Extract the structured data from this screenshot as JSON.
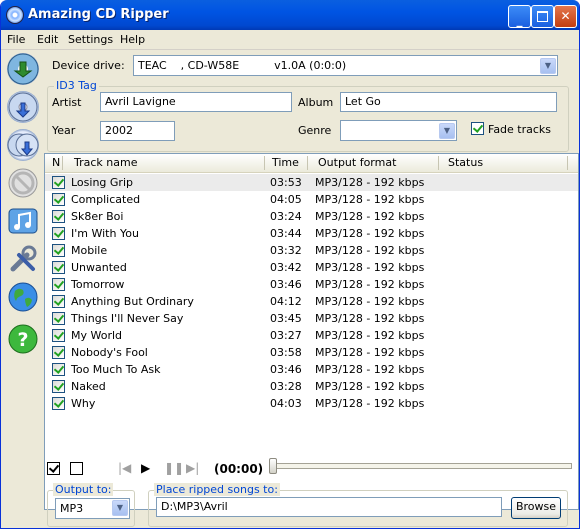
{
  "window": {
    "title": "Amazing CD Ripper"
  },
  "menu": [
    "File",
    "Edit",
    "Settings",
    "Help"
  ],
  "device": {
    "label": "Device drive:",
    "value": "TEAC    , CD-W58E          v1.0A (0:0:0)"
  },
  "id3": {
    "group_title": "ID3 Tag",
    "artist_label": "Artist",
    "artist": "Avril Lavigne",
    "album_label": "Album",
    "album": "Let Go",
    "year_label": "Year",
    "year": "2002",
    "genre_label": "Genre",
    "genre": "",
    "fade_label": "Fade tracks"
  },
  "columns": {
    "num": "N",
    "name": "Track name",
    "time": "Time",
    "format": "Output format",
    "status": "Status"
  },
  "tracks": [
    {
      "name": "Losing Grip",
      "time": "03:53",
      "format": "MP3/128 - 192 kbps",
      "status": ""
    },
    {
      "name": "Complicated",
      "time": "04:05",
      "format": "MP3/128 - 192 kbps",
      "status": ""
    },
    {
      "name": "Sk8er Boi",
      "time": "03:24",
      "format": "MP3/128 - 192 kbps",
      "status": ""
    },
    {
      "name": "I'm With You",
      "time": "03:44",
      "format": "MP3/128 - 192 kbps",
      "status": ""
    },
    {
      "name": "Mobile",
      "time": "03:32",
      "format": "MP3/128 - 192 kbps",
      "status": ""
    },
    {
      "name": "Unwanted",
      "time": "03:42",
      "format": "MP3/128 - 192 kbps",
      "status": ""
    },
    {
      "name": "Tomorrow",
      "time": "03:46",
      "format": "MP3/128 - 192 kbps",
      "status": ""
    },
    {
      "name": "Anything But Ordinary",
      "time": "04:12",
      "format": "MP3/128 - 192 kbps",
      "status": ""
    },
    {
      "name": "Things I'll Never Say",
      "time": "03:45",
      "format": "MP3/128 - 192 kbps",
      "status": ""
    },
    {
      "name": "My World",
      "time": "03:27",
      "format": "MP3/128 - 192 kbps",
      "status": ""
    },
    {
      "name": "Nobody's Fool",
      "time": "03:58",
      "format": "MP3/128 - 192 kbps",
      "status": ""
    },
    {
      "name": "Too Much To Ask",
      "time": "03:46",
      "format": "MP3/128 - 192 kbps",
      "status": ""
    },
    {
      "name": "Naked",
      "time": "03:28",
      "format": "MP3/128 - 192 kbps",
      "status": ""
    },
    {
      "name": "Why",
      "time": "04:03",
      "format": "MP3/128 - 192 kbps",
      "status": ""
    }
  ],
  "player": {
    "time": "(00:00)",
    "position": 0
  },
  "output": {
    "group_title": "Output to:",
    "format": "MP3"
  },
  "destination": {
    "group_title": "Place ripped songs to:",
    "path": "D:\\MP3\\Avril",
    "browse_label": "Browse"
  },
  "sidebar_icons": [
    "rip-cd-icon",
    "rip-selected-icon",
    "rip-all-icon",
    "stop-icon",
    "music-settings-icon",
    "tools-icon",
    "internet-icon",
    "help-icon"
  ]
}
